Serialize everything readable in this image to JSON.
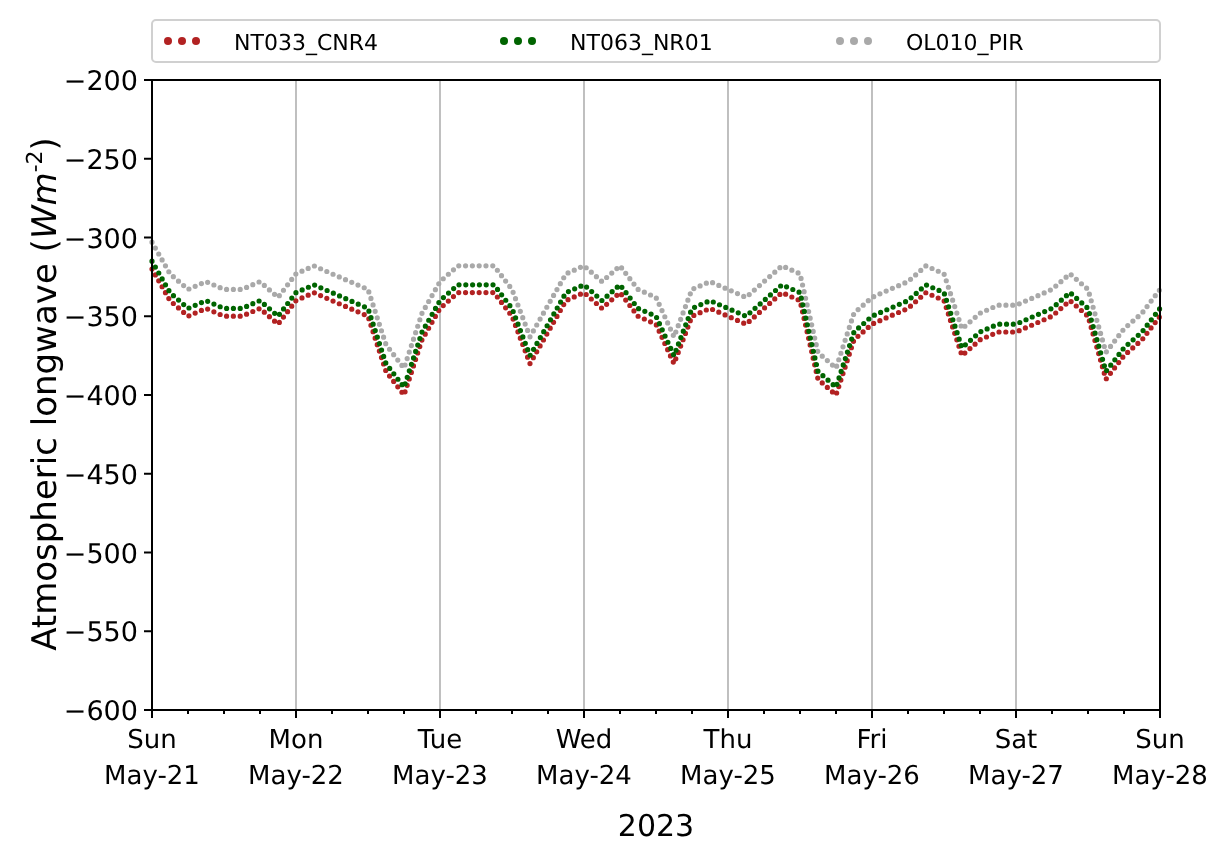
{
  "chart_data": {
    "type": "line",
    "grid": "x",
    "legend": true,
    "xlabel": "2023",
    "ylabel": "Atmospheric longwave (*Wm*$^{-2}$)",
    "categories": [
      "Sun\nMay-21",
      null,
      null,
      null,
      null,
      null,
      null,
      null,
      "Mon\nMay-22",
      null,
      null,
      null,
      null,
      null,
      null,
      null,
      "Tue\nMay-23",
      null,
      null,
      null,
      null,
      null,
      null,
      null,
      "Wed\nMay-24",
      null,
      null,
      null,
      null,
      null,
      null,
      null,
      "Thu\nMay-25",
      null,
      null,
      null,
      null,
      null,
      null,
      null,
      "Fri\nMay-26",
      null,
      null,
      null,
      null,
      null,
      null,
      null,
      "Sat\nMay-27",
      null,
      null,
      null,
      null,
      null,
      null,
      null,
      "Sun\nMay-28"
    ],
    "series": [
      {
        "name": "NT033_CNR4",
        "color": "#b22222",
        "line_style": "dotted",
        "values": [
          -320,
          -340,
          -350,
          -345,
          -350,
          -350,
          -345,
          -355,
          -340,
          -335,
          -340,
          -345,
          -350,
          -385,
          -400,
          -365,
          -345,
          -335,
          -335,
          -335,
          -350,
          -380,
          -360,
          -340,
          -335,
          -345,
          -335,
          -350,
          -355,
          -380,
          -350,
          -345,
          -350,
          -355,
          -345,
          -335,
          -340,
          -390,
          -400,
          -365,
          -355,
          -350,
          -345,
          -335,
          -340,
          -375,
          -365,
          -360,
          -360,
          -355,
          -350,
          -340,
          -350,
          -390,
          -375,
          -365,
          -350
        ]
      },
      {
        "name": "NT063_NR01",
        "color": "#006400",
        "line_style": "dotted",
        "values": [
          -315,
          -335,
          -345,
          -340,
          -345,
          -345,
          -340,
          -350,
          -335,
          -330,
          -335,
          -340,
          -345,
          -380,
          -395,
          -360,
          -340,
          -330,
          -330,
          -330,
          -345,
          -375,
          -355,
          -335,
          -330,
          -340,
          -330,
          -345,
          -350,
          -375,
          -345,
          -340,
          -345,
          -350,
          -340,
          -330,
          -335,
          -385,
          -395,
          -360,
          -350,
          -345,
          -340,
          -330,
          -335,
          -370,
          -360,
          -355,
          -355,
          -350,
          -345,
          -335,
          -345,
          -385,
          -370,
          -360,
          -345
        ]
      },
      {
        "name": "OL010_PIR",
        "color": "#a9a9a9",
        "line_style": "dotted",
        "values": [
          -303,
          -323,
          -333,
          -328,
          -333,
          -333,
          -328,
          -338,
          -323,
          -318,
          -323,
          -328,
          -333,
          -368,
          -383,
          -348,
          -328,
          -318,
          -318,
          -318,
          -333,
          -363,
          -343,
          -323,
          -318,
          -328,
          -318,
          -333,
          -338,
          -363,
          -333,
          -328,
          -333,
          -338,
          -328,
          -318,
          -323,
          -373,
          -383,
          -348,
          -338,
          -333,
          -328,
          -318,
          -323,
          -358,
          -348,
          -343,
          -343,
          -338,
          -333,
          -323,
          -333,
          -373,
          -358,
          -348,
          -333
        ]
      }
    ],
    "ylim": [
      -600,
      -200
    ],
    "yticks": [
      -600,
      -550,
      -500,
      -450,
      -400,
      -350,
      -300,
      -250,
      -200
    ]
  }
}
